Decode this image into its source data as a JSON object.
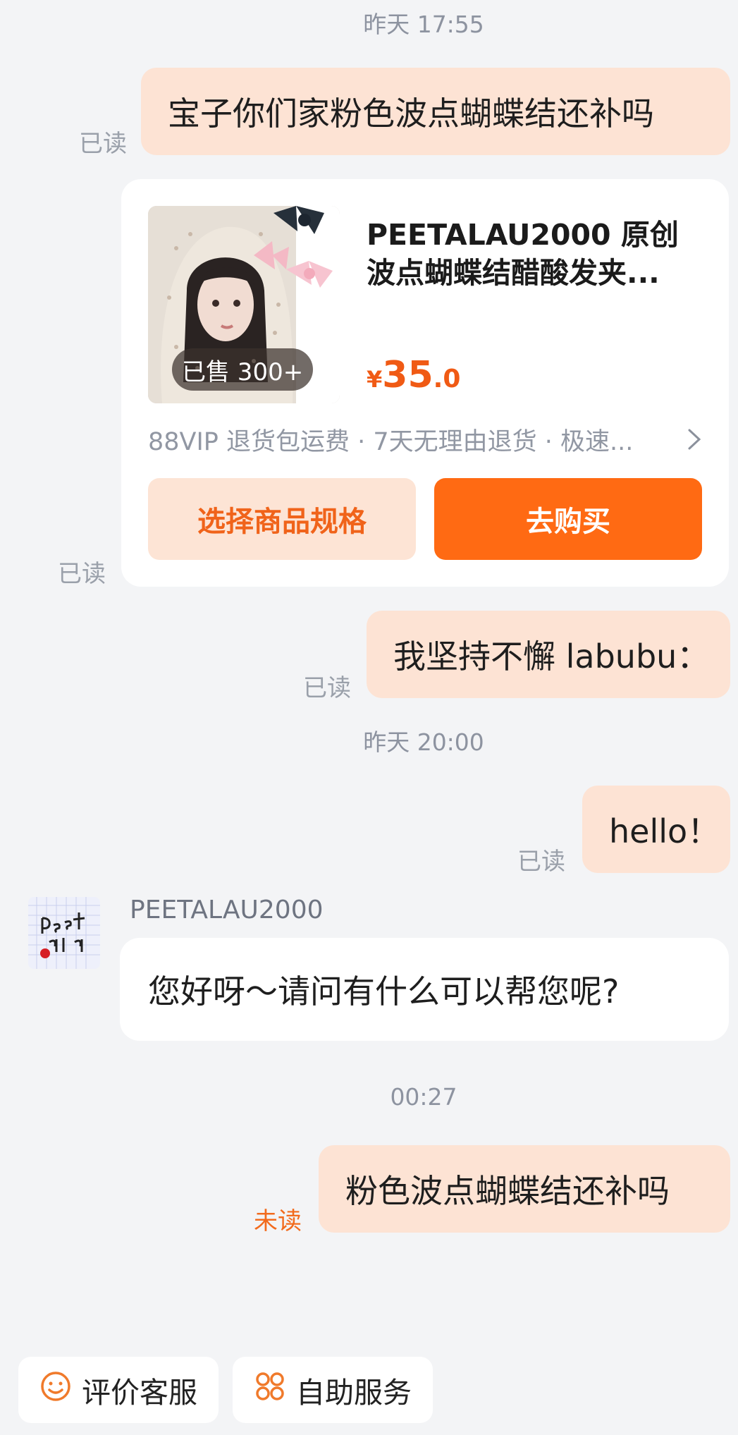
{
  "messages": {
    "ts1": "昨天 17:55",
    "m1_text": "宝子你们家粉色波点蝴蝶结还补吗",
    "m1_status": "已读",
    "ts2": "昨天 20:00",
    "m3_text": "我坚持不懈 labubu：",
    "m3_status": "已读",
    "m4_text": "hello！",
    "m4_status": "已读",
    "seller_name": "PEETALAU2000",
    "m5_text": "您好呀～请问有什么可以帮您呢?",
    "ts3": "00:27",
    "m6_text": "粉色波点蝴蝶结还补吗",
    "m6_status": "未读"
  },
  "product_card": {
    "title": "PEETALAU2000 原创波点蝴蝶结醋酸发夹...",
    "sold": "已售 300+",
    "price_symbol": "¥",
    "price_int": "35",
    "price_dec": ".0",
    "services": "88VIP 退货包运费 · 7天无理由退货 · 极速...",
    "status": "已读",
    "btn_spec": "选择商品规格",
    "btn_buy": "去购买"
  },
  "bottom_bar": {
    "rate_label": "评价客服",
    "self_service_label": "自助服务"
  },
  "colors": {
    "accent": "#ff6a13",
    "bubble": "#fde3d4",
    "background": "#f3f4f6"
  },
  "icons": {
    "chevron": "chevron-right-icon",
    "rate": "smile-icon",
    "service": "grid-icon"
  }
}
